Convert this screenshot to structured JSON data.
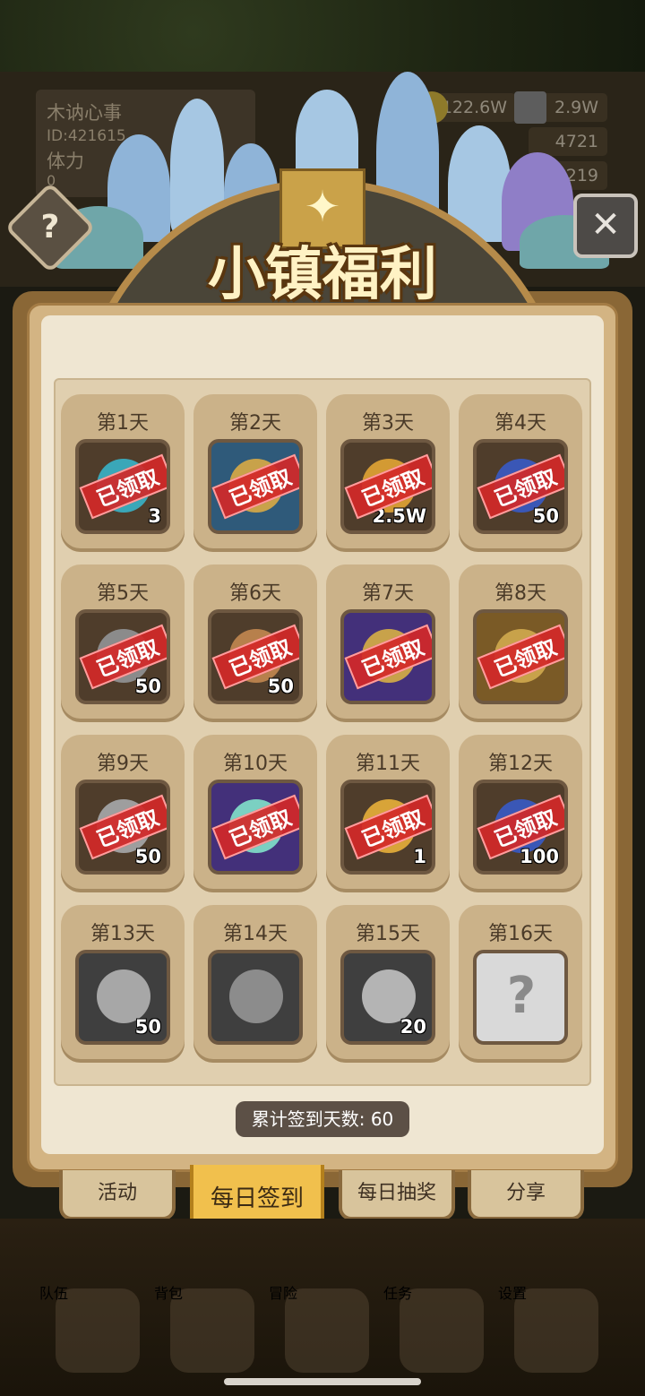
{
  "hud": {
    "player_name": "木讷心事",
    "player_id": "ID:421615",
    "stamina_label": "体力",
    "stamina_value": "0",
    "gold": "122.6W",
    "iron": "2.9W",
    "res2": "4721",
    "res3": "219"
  },
  "popup": {
    "title": "小镇福利",
    "help_label": "?",
    "close_label": "✕"
  },
  "stamp_label": "已领取",
  "days": [
    {
      "label": "第1天",
      "qty": "3",
      "claimed": true,
      "icon": "blue-jar-icon",
      "bg": "#4f3d2b",
      "item": "#3aa7b8"
    },
    {
      "label": "第2天",
      "qty": "",
      "claimed": true,
      "icon": "lock-chest-icon",
      "bg": "#2f5a7a",
      "item": "#c8a24a"
    },
    {
      "label": "第3天",
      "qty": "2.5W",
      "claimed": true,
      "icon": "gold-coins-icon",
      "bg": "#4f3d2b",
      "item": "#d39a33"
    },
    {
      "label": "第4天",
      "qty": "50",
      "claimed": true,
      "icon": "blue-ore-icon",
      "bg": "#4f3d2b",
      "item": "#3a57b6"
    },
    {
      "label": "第5天",
      "qty": "50",
      "claimed": true,
      "icon": "iron-ore-icon",
      "bg": "#4f3d2b",
      "item": "#8b8b8b"
    },
    {
      "label": "第6天",
      "qty": "50",
      "claimed": true,
      "icon": "leather-icon",
      "bg": "#4f3d2b",
      "item": "#b7804c"
    },
    {
      "label": "第7天",
      "qty": "",
      "claimed": true,
      "icon": "lock-chest-icon",
      "bg": "#43307a",
      "item": "#c8a24a"
    },
    {
      "label": "第8天",
      "qty": "",
      "claimed": true,
      "icon": "lock-chest-icon",
      "bg": "#7a5a26",
      "item": "#c8a24a"
    },
    {
      "label": "第9天",
      "qty": "50",
      "claimed": true,
      "icon": "stone-icon",
      "bg": "#4f3d2b",
      "item": "#9e9e9e"
    },
    {
      "label": "第10天",
      "qty": "",
      "claimed": true,
      "icon": "sword-icon",
      "bg": "#43307a",
      "item": "#7bd0c2"
    },
    {
      "label": "第11天",
      "qty": "1",
      "claimed": true,
      "icon": "sparkle-scroll-icon",
      "bg": "#4f3d2b",
      "item": "#d8a438"
    },
    {
      "label": "第12天",
      "qty": "100",
      "claimed": true,
      "icon": "blue-ore-icon",
      "bg": "#4f3d2b",
      "item": "#3a57b6"
    },
    {
      "label": "第13天",
      "qty": "50",
      "claimed": false,
      "icon": "wood-log-icon",
      "bg": "#3f3f3f",
      "item": "#a7a7a7"
    },
    {
      "label": "第14天",
      "qty": "",
      "claimed": false,
      "icon": "backpack-icon",
      "bg": "#3f3f3f",
      "item": "#8c8c8c"
    },
    {
      "label": "第15天",
      "qty": "20",
      "claimed": false,
      "icon": "rune-stone-icon",
      "bg": "#3f3f3f",
      "item": "#b4b4b4"
    },
    {
      "label": "第16天",
      "qty": "",
      "claimed": false,
      "icon": "mystery-question-icon",
      "bg": "#d9d9d9",
      "item": "#ffffff"
    }
  ],
  "summary": "累计签到天数: 60",
  "tabs": [
    {
      "label": "活动"
    },
    {
      "label": "每日签到"
    },
    {
      "label": "每日抽奖"
    },
    {
      "label": "分享"
    }
  ],
  "bottom_nav": [
    {
      "label": "队伍"
    },
    {
      "label": "背包"
    },
    {
      "label": "冒险"
    },
    {
      "label": "任务"
    },
    {
      "label": "设置"
    }
  ]
}
